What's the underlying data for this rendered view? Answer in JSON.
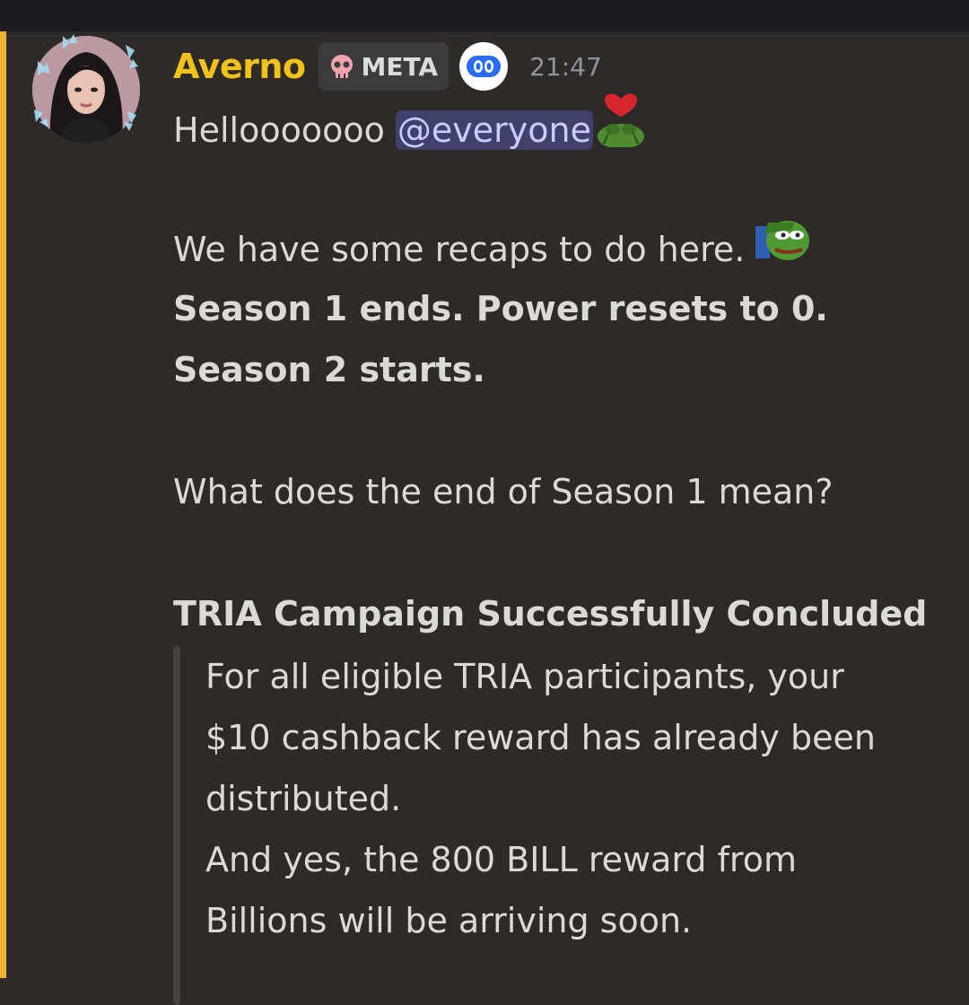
{
  "message": {
    "author": "Averno",
    "role_tag": "META",
    "timestamp": "21:47",
    "greeting_text": "Hellooooooo ",
    "mention": "@everyone",
    "line_recap": "We have some recaps to do here. ",
    "bold_line_1": "Season 1 ends. Power resets to 0.",
    "bold_line_2": "Season 2 starts.",
    "question": "What does the end of Season 1 mean?",
    "heading": "TRIA Campaign Successfully Concluded",
    "quote_lines": [
      "For all eligible TRIA participants, your",
      "$10 cashback reward has already been",
      "distributed.",
      "And yes, the 800 BILL reward from",
      "Billions will be arriving soon."
    ]
  },
  "colors": {
    "author": "#f1c21b",
    "mention_bar": "#f0b132",
    "mention_bg": "#3f416a",
    "background": "#2d2a27"
  },
  "icons": [
    "skull-icon",
    "bot-badge-icon",
    "pepe-heart-emoji",
    "pepe-salute-emoji"
  ]
}
